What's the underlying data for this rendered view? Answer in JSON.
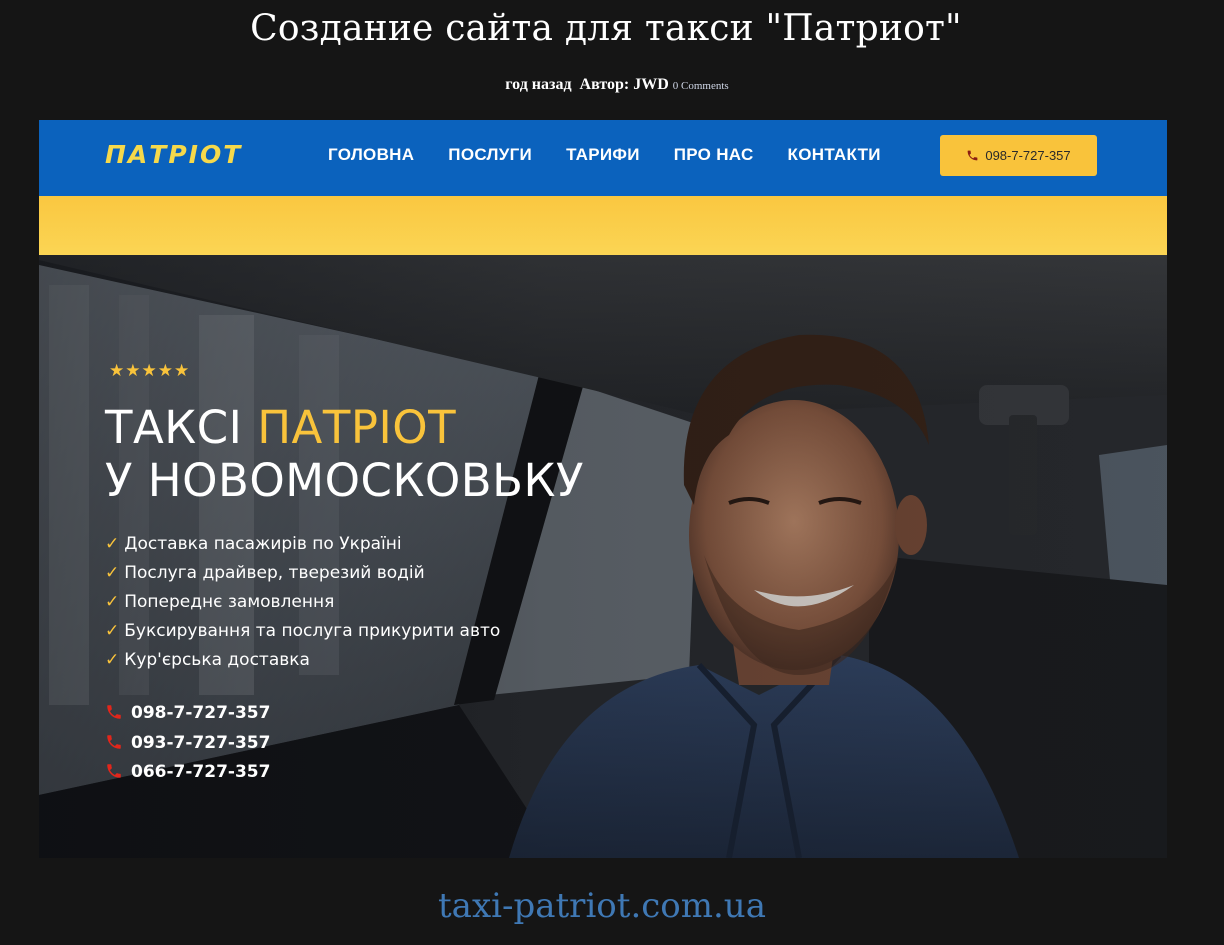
{
  "post": {
    "title": "Создание сайта для такси \"Патриот\"",
    "time": "год назад",
    "author": "Автор: JWD",
    "comments": "0 Comments"
  },
  "site": {
    "logo": "ПАТРІОТ",
    "nav": [
      "ГОЛОВНА",
      "ПОСЛУГИ",
      "ТАРИФИ",
      "ПРО НАС",
      "КОНТАКТИ"
    ],
    "header_phone": "098-7-727-357",
    "colors": {
      "header_blue": "#0b62bd",
      "yellow": "#f9c33b",
      "logo_yellow": "#f6d94b"
    }
  },
  "hero": {
    "rating": "★★★★★",
    "title_line1_prefix": "ТАКСІ ",
    "title_line1_accent": "ПАТРІОТ",
    "title_line2": "У НОВОМОСКОВЬКУ",
    "check": "✓",
    "features": [
      "Доставка пасажирів по Україні",
      "Послуга драйвер, тверезий водій",
      "Попереднє замовлення",
      "Буксирування та послуга прикурити авто",
      "Кур'єрська доставка"
    ],
    "phones": [
      "098-7-727-357",
      "093-7-727-357",
      "066-7-727-357"
    ]
  },
  "footer": {
    "site_url": "taxi-patriot.com.ua"
  }
}
